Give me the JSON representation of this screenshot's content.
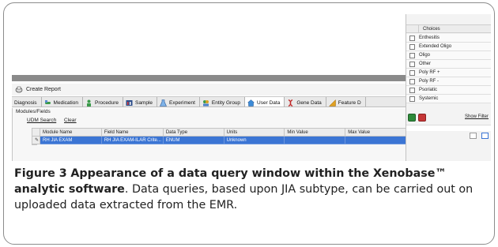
{
  "toolbar": {
    "create_report": "Create Report"
  },
  "tabs": [
    {
      "label": "Diagnosis",
      "icon": "none"
    },
    {
      "label": "Medication",
      "icon": "pill-icon"
    },
    {
      "label": "Procedure",
      "icon": "person-icon"
    },
    {
      "label": "Sample",
      "icon": "sample-icon"
    },
    {
      "label": "Experiment",
      "icon": "flask-icon"
    },
    {
      "label": "Entity Group",
      "icon": "group-icon"
    },
    {
      "label": "User Data",
      "icon": "user-data-icon"
    },
    {
      "label": "Gene Data",
      "icon": "dna-icon"
    },
    {
      "label": "Feature D",
      "icon": "feature-icon"
    }
  ],
  "panel": {
    "title": "Modules/Fields",
    "udm_search": "UDM Search",
    "clear": "Clear"
  },
  "grid": {
    "headers": [
      "Module Name",
      "Field Name",
      "Data Type",
      "Units",
      "Min Value",
      "Max Value"
    ],
    "rows": [
      [
        "RH JIA EXAM",
        "RH JIA EXAM-ILAR Crite...",
        "ENUM",
        "Unknown",
        "",
        ""
      ]
    ]
  },
  "choices": {
    "header": "Choices",
    "items": [
      "Enthesitis",
      "Extended Oligo",
      "Oligo",
      "Other",
      "Poly RF +",
      "Poly RF -",
      "Psoriatic",
      "Systemic"
    ],
    "show_filter": "Show Filter"
  },
  "caption": {
    "label": "Figure 3",
    "title": "Appearance of a data query window within the Xenobase™ analytic software",
    "text": ". Data queries, based upon JIA subtype, can be carried out on uploaded data extracted from the EMR."
  }
}
